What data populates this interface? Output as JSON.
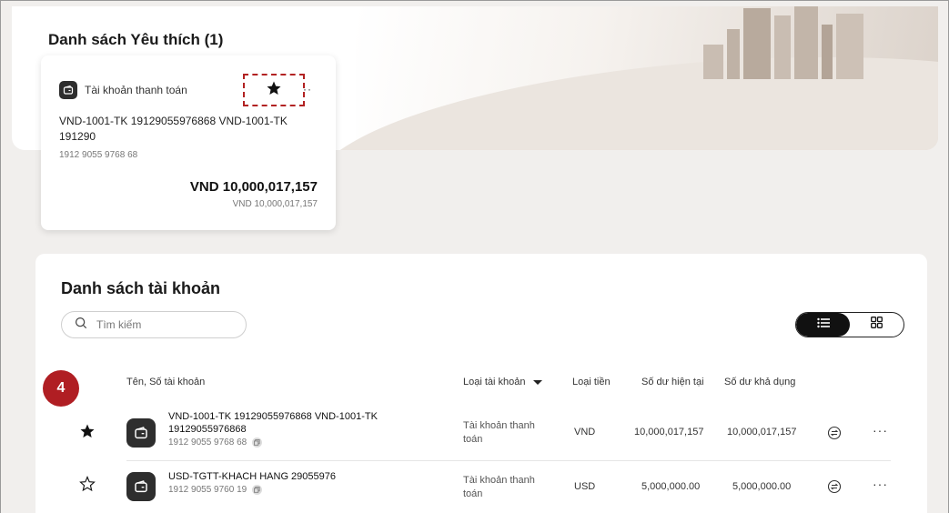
{
  "favorites": {
    "title": "Danh sách Yêu thích (1)",
    "card": {
      "account_type": "Tài khoản thanh toán",
      "more_label": "··",
      "name": "VND-1001-TK 19129055976868 VND-1001-TK 191290",
      "number": "1912 9055 9768 68",
      "amount": "VND 10,000,017,157",
      "amount_sub": "VND 10,000,017,157"
    }
  },
  "accounts": {
    "title": "Danh sách tài khoản",
    "search": {
      "placeholder": "Tìm kiếm"
    },
    "columns": {
      "name": "Tên, Số tài khoản",
      "type": "Loại tài khoản",
      "currency": "Loại tiền",
      "current": "Số dư hiện tại",
      "available": "Số dư khả dụng"
    },
    "rows": [
      {
        "favorite": true,
        "name": "VND-1001-TK 19129055976868 VND-1001-TK 19129055976868",
        "number": "1912 9055 9768 68",
        "type": "Tài khoản thanh toán",
        "currency": "VND",
        "current": "10,000,017,157",
        "available": "10,000,017,157",
        "more": "···"
      },
      {
        "favorite": false,
        "name": "USD-TGTT-KHACH HANG 29055976",
        "number": "1912 9055 9760 19",
        "type": "Tài khoản thanh toán",
        "currency": "USD",
        "current": "5,000,000.00",
        "available": "5,000,000.00",
        "more": "···"
      }
    ]
  },
  "step_badge": "4",
  "colors": {
    "accent": "#b01e23",
    "dark": "#2e2e2e"
  }
}
